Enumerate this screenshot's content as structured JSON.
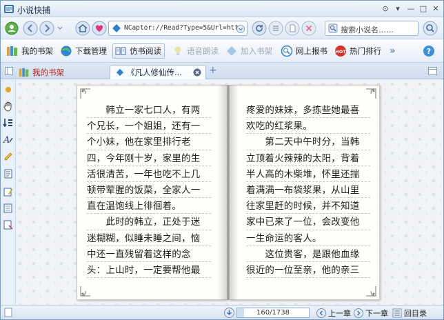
{
  "window": {
    "title": "小说快捕"
  },
  "nav": {
    "address": "NCaptor://Read?Type=5&Url=http",
    "search_placeholder": "搜索小说名……"
  },
  "toolbar": {
    "bookshelf": "我的书架",
    "download": "下载管理",
    "reader": "仿书阅读",
    "voice": "语音朗读",
    "add_shelf": "加入书架",
    "online_report": "网上报书",
    "hot_rank": "热门排行",
    "more": "»"
  },
  "tabs": {
    "shelf": "我的书架",
    "book": "《凡人修仙传..."
  },
  "book": {
    "left_lines": [
      "　　韩立一家七口人，有两",
      "个兄长，一个姐姐，还有一",
      "个小妹，他在家里排行老",
      "四，今年刚十岁，家里的生",
      "活很清苦，一年也吃不上几",
      "顿带荤腥的饭菜，全家人一",
      "直在温饱线上徘徊着。",
      "　　此时的韩立，正处于迷",
      "迷糊糊，似睡未睡之间，恼",
      "中还一直残留着这样的念",
      "头：上山时，一定要帮他最"
    ],
    "right_lines": [
      "疼爱的妹妹，多拣些她最喜",
      "欢吃的红浆果。",
      "　　第二天中午时分，当韩",
      "立顶着火辣辣的太阳，背着",
      "半人高的木柴堆，怀里还揣",
      "着满满一布袋浆果，从山里",
      "往家里赶的时候，并不知道",
      "家中已来了一位，会改变他",
      "一生命运的客人。",
      "　　这位贵客，是跟他血缘",
      "很近的一位至亲，他的亲三"
    ]
  },
  "status": {
    "progress_text": "160/1738",
    "progress_fraction": 0.092,
    "prev": "上一章",
    "next": "下一章",
    "toc": "回目录"
  },
  "colors": {
    "accent": "#3a6fb5",
    "active_tab_text": "#b3261e"
  }
}
